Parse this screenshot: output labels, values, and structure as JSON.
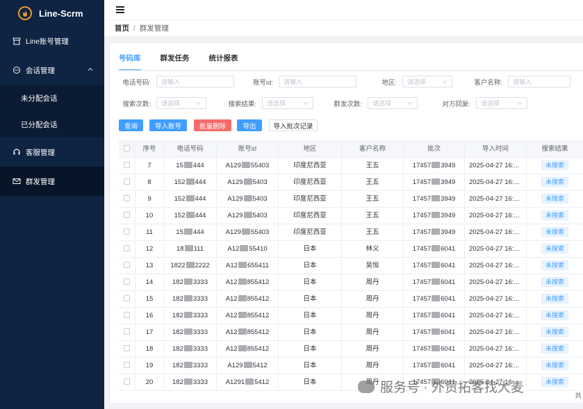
{
  "app": {
    "name": "Line-Scrm",
    "brand_color": "#e89a2b"
  },
  "sidebar": {
    "items": [
      {
        "label": "Line账号管理",
        "icon": "store-icon"
      },
      {
        "label": "会话管理",
        "icon": "chat-icon",
        "expanded": true,
        "children": [
          {
            "label": "未分配会话"
          },
          {
            "label": "已分配会话"
          }
        ]
      },
      {
        "label": "客服管理",
        "icon": "headset-icon"
      },
      {
        "label": "群发管理",
        "icon": "mail-icon",
        "active": true
      }
    ]
  },
  "breadcrumb": {
    "home": "首页",
    "separator": "/",
    "current": "群发管理"
  },
  "tabs": [
    {
      "label": "号码库",
      "active": true
    },
    {
      "label": "群发任务"
    },
    {
      "label": "统计报表"
    }
  ],
  "filters": {
    "phone": {
      "label": "电话号码:",
      "placeholder": "请输入"
    },
    "account_id": {
      "label": "账号id:",
      "placeholder": "请输入"
    },
    "region": {
      "label": "地区:",
      "placeholder": "请选择"
    },
    "customer": {
      "label": "客户名称:",
      "placeholder": "请输入"
    },
    "search_count": {
      "label": "搜索次数:",
      "placeholder": "请选择"
    },
    "search_result": {
      "label": "搜索结果:",
      "placeholder": "请选择"
    },
    "send_count": {
      "label": "群发次数:",
      "placeholder": "请选择"
    },
    "reply": {
      "label": "对方回复:",
      "placeholder": "请选择"
    }
  },
  "buttons": {
    "query": "查询",
    "import_account": "导入账号",
    "batch_delete": "批量删除",
    "export": "导出",
    "import_batch_record": "导入批次记录"
  },
  "table": {
    "columns": [
      "",
      "序号",
      "电话号码",
      "账号id",
      "地区",
      "客户名称",
      "批次",
      "导入时间",
      "搜索结果"
    ],
    "rows": [
      {
        "no": "7",
        "phone": [
          "15",
          "444"
        ],
        "acct": [
          "A129",
          "55403"
        ],
        "region": "印度尼西亚",
        "customer": "王五",
        "batch": [
          "17457",
          "3949"
        ],
        "time": "2025-04-27 16:...",
        "result": "未搜索"
      },
      {
        "no": "8",
        "phone": [
          "152",
          "444"
        ],
        "acct": [
          "A129",
          "5403"
        ],
        "region": "印度尼西亚",
        "customer": "王五",
        "batch": [
          "17457",
          "3949"
        ],
        "time": "2025-04-27 16:...",
        "result": "未搜索"
      },
      {
        "no": "9",
        "phone": [
          "152",
          "444"
        ],
        "acct": [
          "A129",
          "5403"
        ],
        "region": "印度尼西亚",
        "customer": "王五",
        "batch": [
          "17457",
          "3949"
        ],
        "time": "2025-04-27 16:...",
        "result": "未搜索"
      },
      {
        "no": "10",
        "phone": [
          "152",
          "444"
        ],
        "acct": [
          "A129",
          "5403"
        ],
        "region": "印度尼西亚",
        "customer": "王五",
        "batch": [
          "17457",
          "3949"
        ],
        "time": "2025-04-27 16:...",
        "result": "未搜索"
      },
      {
        "no": "11",
        "phone": [
          "15",
          "444"
        ],
        "acct": [
          "A129",
          "55403"
        ],
        "region": "印度尼西亚",
        "customer": "王五",
        "batch": [
          "17457",
          "3949"
        ],
        "time": "2025-04-27 16:...",
        "result": "未搜索"
      },
      {
        "no": "12",
        "phone": [
          "18",
          "111"
        ],
        "acct": [
          "A12",
          "55410"
        ],
        "region": "日本",
        "customer": "林义",
        "batch": [
          "17457",
          "6041"
        ],
        "time": "2025-04-27 16:...",
        "result": "未搜索"
      },
      {
        "no": "13",
        "phone": [
          "1822",
          "2222"
        ],
        "acct": [
          "A12",
          "655411"
        ],
        "region": "日本",
        "customer": "吴恒",
        "batch": [
          "17457",
          "6041"
        ],
        "time": "2025-04-27 16:...",
        "result": "未搜索"
      },
      {
        "no": "14",
        "phone": [
          "182",
          "3333"
        ],
        "acct": [
          "A12",
          "855412"
        ],
        "region": "日本",
        "customer": "周丹",
        "batch": [
          "17457",
          "6041"
        ],
        "time": "2025-04-27 16:...",
        "result": "未搜索"
      },
      {
        "no": "15",
        "phone": [
          "182",
          "3333"
        ],
        "acct": [
          "A12",
          "855412"
        ],
        "region": "日本",
        "customer": "周丹",
        "batch": [
          "17457",
          "6041"
        ],
        "time": "2025-04-27 16:...",
        "result": "未搜索"
      },
      {
        "no": "16",
        "phone": [
          "182",
          "3333"
        ],
        "acct": [
          "A12",
          "855412"
        ],
        "region": "日本",
        "customer": "周丹",
        "batch": [
          "17457",
          "6041"
        ],
        "time": "2025-04-27 16:...",
        "result": "未搜索"
      },
      {
        "no": "17",
        "phone": [
          "182",
          "3333"
        ],
        "acct": [
          "A12",
          "855412"
        ],
        "region": "日本",
        "customer": "周丹",
        "batch": [
          "17457",
          "6041"
        ],
        "time": "2025-04-27 16:...",
        "result": "未搜索"
      },
      {
        "no": "18",
        "phone": [
          "182",
          "3333"
        ],
        "acct": [
          "A12",
          "855412"
        ],
        "region": "日本",
        "customer": "周丹",
        "batch": [
          "17457",
          "6041"
        ],
        "time": "2025-04-27 16:...",
        "result": "未搜索"
      },
      {
        "no": "19",
        "phone": [
          "182",
          "3333"
        ],
        "acct": [
          "A129",
          "5412"
        ],
        "region": "日本",
        "customer": "周丹",
        "batch": [
          "17457",
          "6041"
        ],
        "time": "2025-04-27 16:...",
        "result": "未搜索"
      },
      {
        "no": "20",
        "phone": [
          "182",
          "3333"
        ],
        "acct": [
          "A1291",
          "5412"
        ],
        "region": "日本",
        "customer": "周丹",
        "batch": [
          "17457",
          "6041"
        ],
        "time": "2025-04-27 16:...",
        "result": "未搜索"
      }
    ]
  },
  "footer": {
    "total_prefix": "共"
  },
  "watermark": "服务号 · 外贸拓客找大麦"
}
